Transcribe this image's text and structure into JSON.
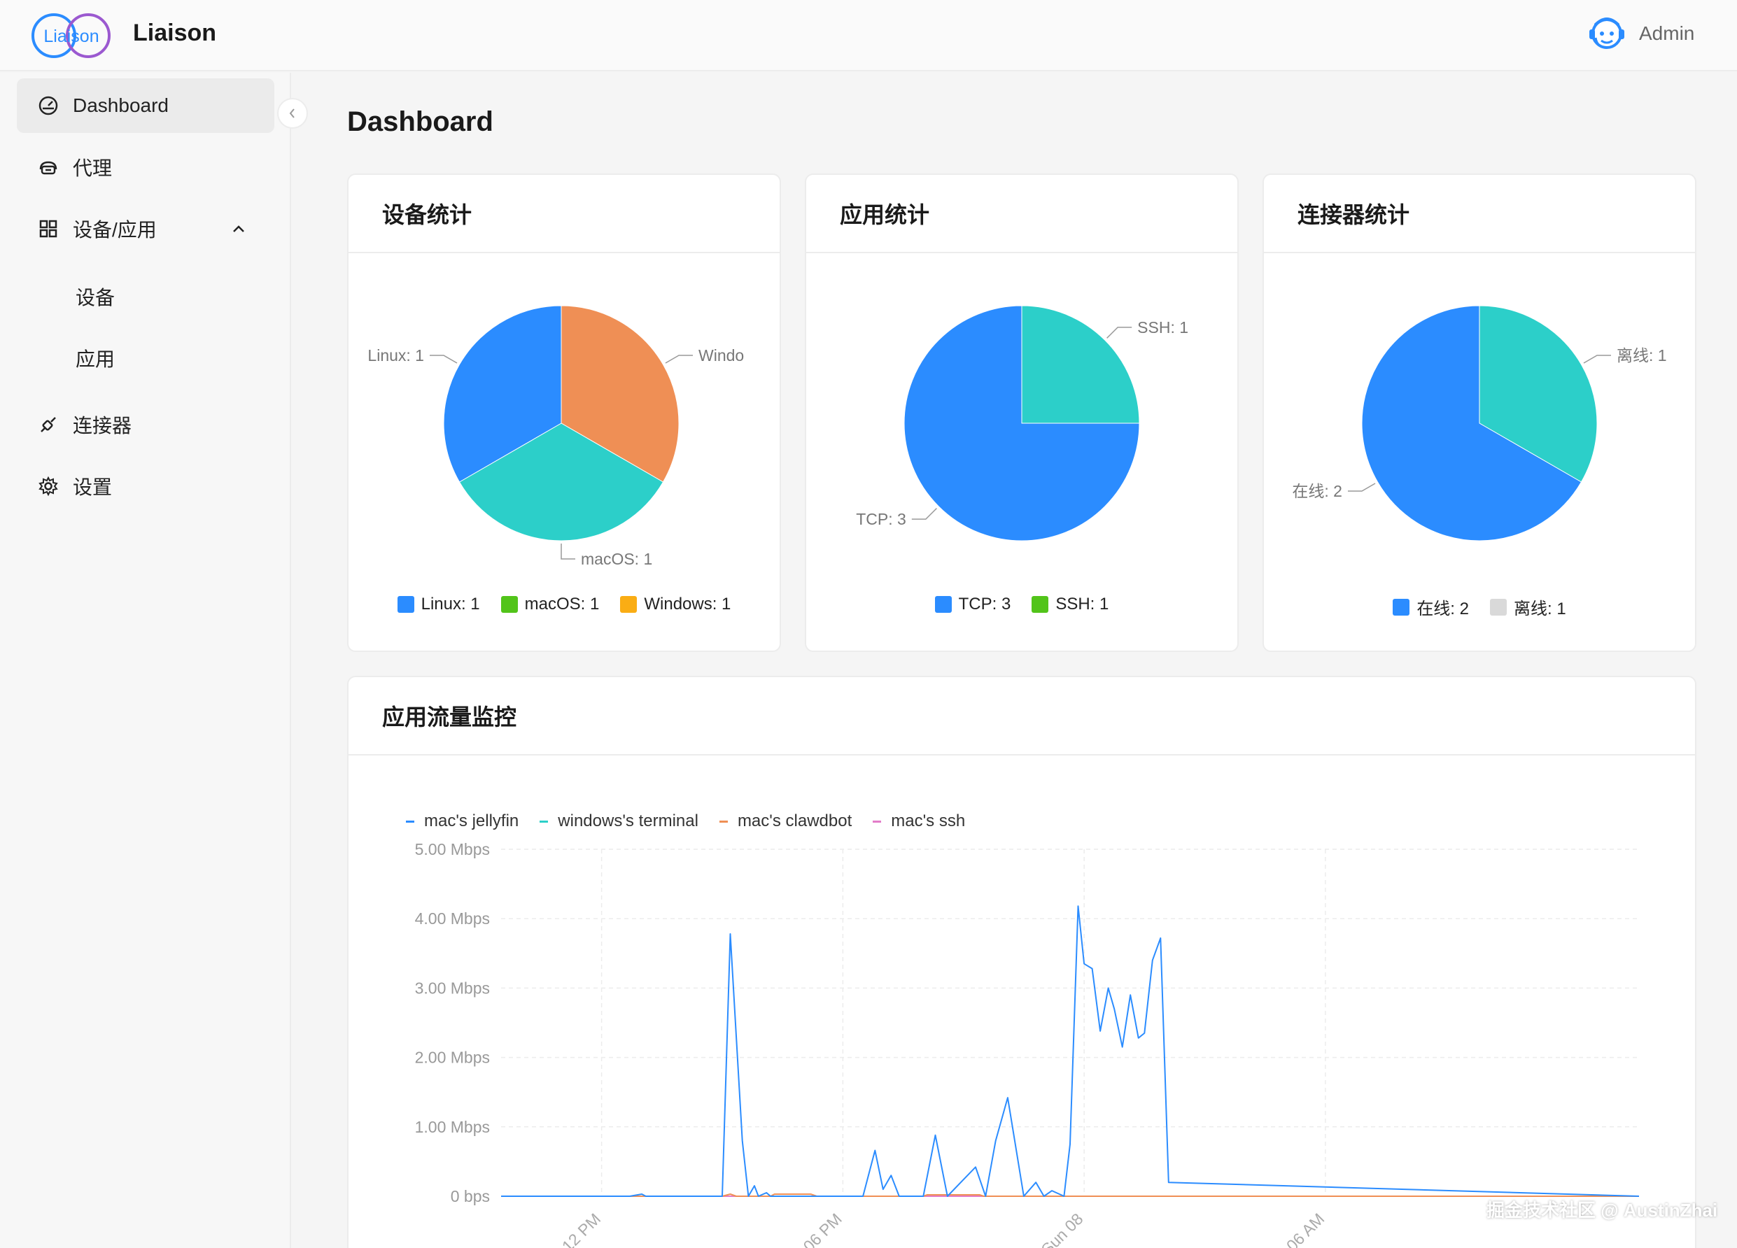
{
  "app": {
    "name": "Liaison",
    "logo_text": "Liaison",
    "user": "Admin"
  },
  "sidebar": {
    "items": [
      {
        "label": "Dashboard",
        "icon": "dashboard-icon",
        "active": true
      },
      {
        "label": "代理",
        "icon": "proxy-icon"
      },
      {
        "label": "设备/应用",
        "icon": "apps-grid-icon",
        "expanded": true,
        "children": [
          {
            "label": "设备"
          },
          {
            "label": "应用"
          }
        ]
      },
      {
        "label": "连接器",
        "icon": "connector-icon"
      },
      {
        "label": "设置",
        "icon": "gear-icon"
      }
    ]
  },
  "page": {
    "title": "Dashboard"
  },
  "colors": {
    "blue": "#2b8cff",
    "teal": "#2ccfc9",
    "orange": "#ef8f55",
    "green": "#52c41a",
    "amber": "#faad14",
    "grey": "#d9d9d9",
    "pink": "#e37cc9"
  },
  "cards": {
    "devices": {
      "title": "设备统计"
    },
    "apps": {
      "title": "应用统计"
    },
    "connectors": {
      "title": "连接器统计"
    },
    "traffic": {
      "title": "应用流量监控"
    }
  },
  "watermark": "掘金技术社区 @ AustinZhai",
  "chart_data": [
    {
      "type": "pie",
      "title": "设备统计",
      "slices": [
        {
          "name": "Linux",
          "value": 1,
          "label": "Linux: 1",
          "callout": "Linux: 1",
          "color": "#2b8cff",
          "legend_color": "#2b8cff"
        },
        {
          "name": "macOS",
          "value": 1,
          "label": "macOS: 1",
          "callout": "macOS: 1",
          "color": "#2ccfc9",
          "legend_color": "#52c41a"
        },
        {
          "name": "Windows",
          "value": 1,
          "label": "Windows: 1",
          "callout": "Windo",
          "color": "#ef8f55",
          "legend_color": "#faad14"
        }
      ],
      "legend": "bottom"
    },
    {
      "type": "pie",
      "title": "应用统计",
      "slices": [
        {
          "name": "TCP",
          "value": 3,
          "label": "TCP: 3",
          "callout": "TCP: 3",
          "color": "#2b8cff",
          "legend_color": "#2b8cff"
        },
        {
          "name": "SSH",
          "value": 1,
          "label": "SSH: 1",
          "callout": "SSH: 1",
          "color": "#2ccfc9",
          "legend_color": "#52c41a"
        }
      ],
      "legend": "bottom"
    },
    {
      "type": "pie",
      "title": "连接器统计",
      "slices": [
        {
          "name": "在线",
          "value": 2,
          "label": "在线: 2",
          "callout": "在线: 2",
          "color": "#2b8cff",
          "legend_color": "#2b8cff"
        },
        {
          "name": "离线",
          "value": 1,
          "label": "离线: 1",
          "callout": "离线: 1",
          "color": "#2ccfc9",
          "legend_color": "#d9d9d9"
        }
      ],
      "legend": "bottom"
    },
    {
      "type": "line",
      "title": "应用流量监控",
      "y_unit": "Mbps",
      "ylim": [
        0,
        5
      ],
      "y_ticks": [
        "0 bps",
        "1.00 Mbps",
        "2.00 Mbps",
        "3.00 Mbps",
        "4.00 Mbps",
        "5.00 Mbps"
      ],
      "x_range_hours": [
        -2.5,
        25.8
      ],
      "x_ticks": [
        {
          "label": "12 PM",
          "hour": 0
        },
        {
          "label": "06 PM",
          "hour": 6
        },
        {
          "label": "Sun 08",
          "hour": 12
        },
        {
          "label": "06 AM",
          "hour": 18
        }
      ],
      "grid": true,
      "legend": "top-left",
      "series": [
        {
          "name": "mac's jellyfin",
          "color": "#2b8cff",
          "x": [
            -2.5,
            0.7,
            1.0,
            1.1,
            3.0,
            3.2,
            3.5,
            3.65,
            3.8,
            3.9,
            4.1,
            4.2,
            4.3,
            6.5,
            6.8,
            7.0,
            7.2,
            7.4,
            7.6,
            8.0,
            8.3,
            8.6,
            9.0,
            9.3,
            9.55,
            9.8,
            10.1,
            10.5,
            10.8,
            11.0,
            11.2,
            11.5,
            11.65,
            11.85,
            12.0,
            12.2,
            12.4,
            12.6,
            12.75,
            12.95,
            13.15,
            13.35,
            13.5,
            13.7,
            13.9,
            14.1,
            25.8
          ],
          "y": [
            0,
            0,
            0.03,
            0,
            0,
            3.78,
            0.8,
            0,
            0.15,
            0,
            0.05,
            0,
            0,
            0,
            0.66,
            0.1,
            0.3,
            0,
            0,
            0,
            0.88,
            0,
            0.24,
            0.42,
            0,
            0.8,
            1.42,
            0,
            0.2,
            0,
            0.08,
            0,
            0.75,
            4.18,
            3.35,
            3.28,
            2.38,
            3.0,
            2.7,
            2.15,
            2.9,
            2.28,
            2.35,
            3.4,
            3.72,
            0.2,
            0
          ]
        },
        {
          "name": "windows's terminal",
          "color": "#2ccfc9",
          "x": [
            -2.5,
            25.8
          ],
          "y": [
            0,
            0
          ]
        },
        {
          "name": "mac's clawdbot",
          "color": "#ef8f55",
          "x": [
            -2.5,
            3.0,
            3.2,
            3.35,
            4.2,
            4.3,
            5.2,
            5.35,
            8.0,
            8.1,
            9.4,
            9.5,
            25.8
          ],
          "y": [
            0,
            0,
            0.03,
            0,
            0,
            0.03,
            0.03,
            0,
            0,
            0.02,
            0.02,
            0,
            0
          ]
        },
        {
          "name": "mac's ssh",
          "color": "#e37cc9",
          "x": [
            -2.5,
            25.8
          ],
          "y": [
            0,
            0
          ]
        }
      ]
    }
  ]
}
